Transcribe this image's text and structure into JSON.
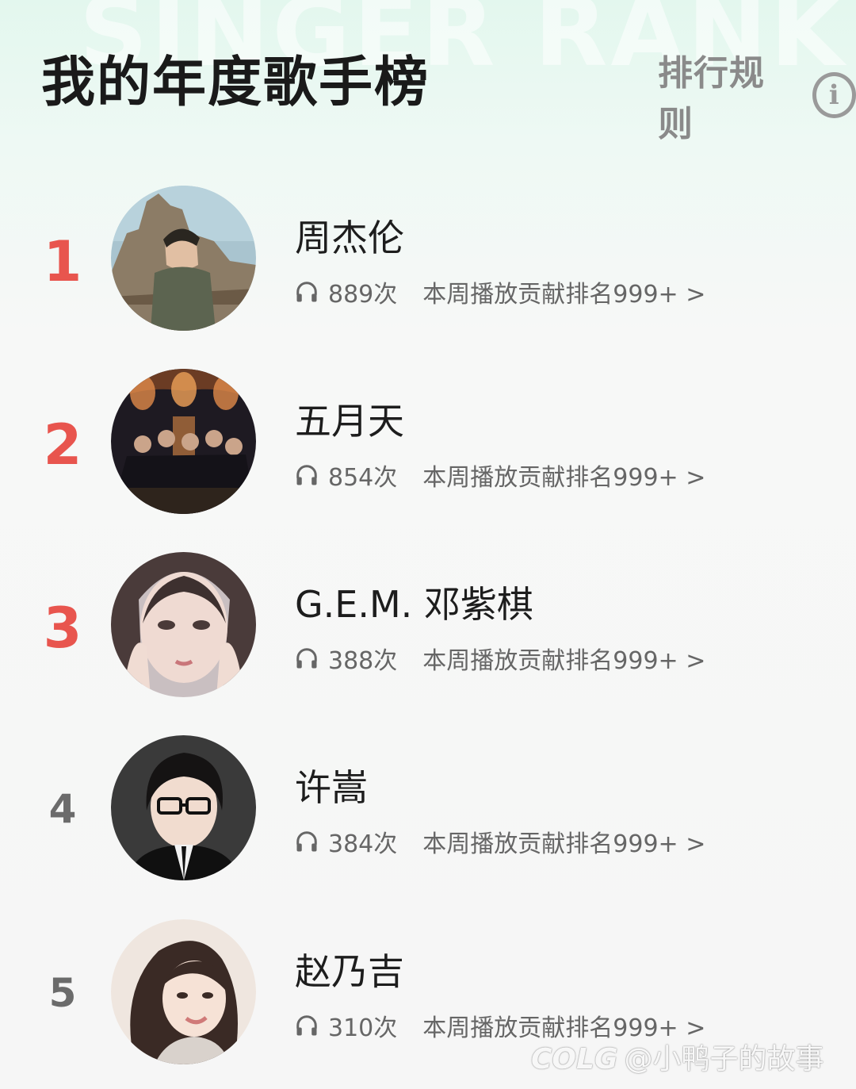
{
  "header": {
    "background_text": "SINGER RANK",
    "title": "我的年度歌手榜",
    "rules_label": "排行规则",
    "info_icon": "info-circle-icon"
  },
  "colors": {
    "rank_top": "#e8554e",
    "rank_normal": "#6b6b6b",
    "header_bg": "#e3f7ee",
    "page_bg": "#f6f6f6"
  },
  "singers": [
    {
      "rank": "1",
      "name": "周杰伦",
      "plays": "889次",
      "contribution": "本周播放贡献排名999+ >"
    },
    {
      "rank": "2",
      "name": "五月天",
      "plays": "854次",
      "contribution": "本周播放贡献排名999+ >"
    },
    {
      "rank": "3",
      "name": "G.E.M. 邓紫棋",
      "plays": "388次",
      "contribution": "本周播放贡献排名999+ >"
    },
    {
      "rank": "4",
      "name": "许嵩",
      "plays": "384次",
      "contribution": "本周播放贡献排名999+ >"
    },
    {
      "rank": "5",
      "name": "赵乃吉",
      "plays": "310次",
      "contribution": "本周播放贡献排名999+ >"
    }
  ],
  "watermark": {
    "logo": "COLG",
    "text": "@小鸭子的故事"
  }
}
